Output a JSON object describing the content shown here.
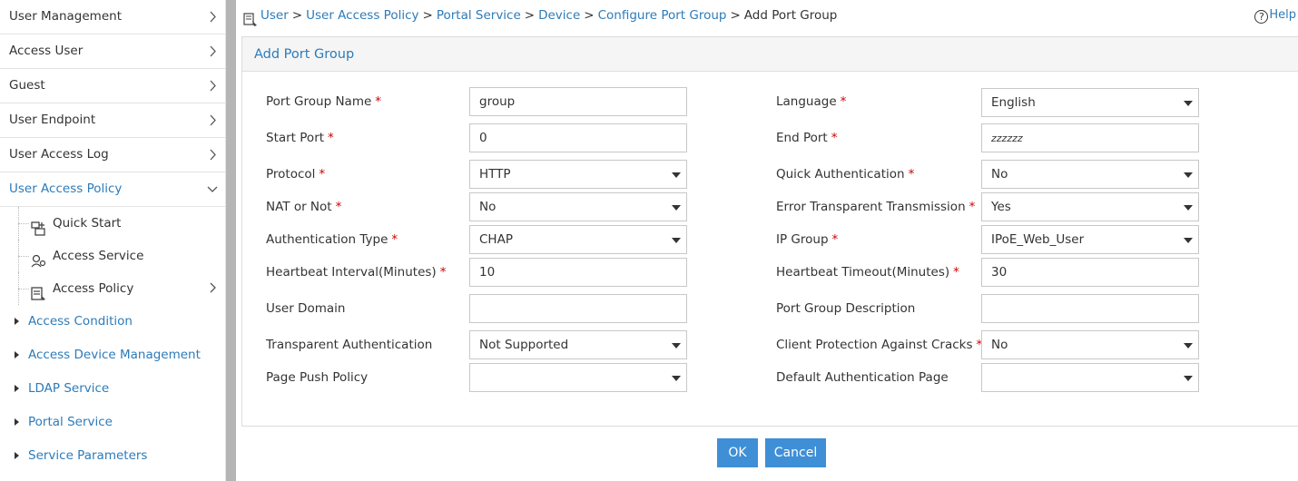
{
  "sidebar": {
    "top_items": [
      {
        "label": "User Management"
      },
      {
        "label": "Access User"
      },
      {
        "label": "Guest"
      },
      {
        "label": "User Endpoint"
      },
      {
        "label": "User Access Log"
      },
      {
        "label": "User Access Policy"
      }
    ],
    "sub_items": [
      {
        "label": "Quick Start"
      },
      {
        "label": "Access Service"
      },
      {
        "label": "Access Policy"
      }
    ],
    "tree_items": [
      {
        "label": "Access Condition"
      },
      {
        "label": "Access Device Management"
      },
      {
        "label": "LDAP Service"
      },
      {
        "label": "Portal Service"
      },
      {
        "label": "Service Parameters"
      }
    ]
  },
  "breadcrumb": {
    "items": [
      "User",
      "User Access Policy",
      "Portal Service",
      "Device",
      "Configure Port Group"
    ],
    "current": "Add Port Group",
    "separator": ">"
  },
  "help": {
    "label": "Help",
    "icon_glyph": "?"
  },
  "panel": {
    "title": "Add Port Group"
  },
  "form": {
    "port_group_name": {
      "label": "Port Group Name",
      "value": "group",
      "required": "*"
    },
    "language": {
      "label": "Language",
      "value": "English",
      "required": "*"
    },
    "start_port": {
      "label": "Start Port",
      "value": "0",
      "required": "*"
    },
    "end_port": {
      "label": "End Port",
      "value": "zzzzzz",
      "required": "*"
    },
    "protocol": {
      "label": "Protocol",
      "value": "HTTP",
      "required": "*"
    },
    "quick_auth": {
      "label": "Quick Authentication",
      "value": "No",
      "required": "*"
    },
    "nat": {
      "label": "NAT or Not",
      "value": "No",
      "required": "*"
    },
    "error_transparent": {
      "label": "Error Transparent Transmission",
      "value": "Yes",
      "required": "*"
    },
    "auth_type": {
      "label": "Authentication Type",
      "value": "CHAP",
      "required": "*"
    },
    "ip_group": {
      "label": "IP Group",
      "value": "IPoE_Web_User",
      "required": "*"
    },
    "heartbeat_interval": {
      "label": "Heartbeat Interval(Minutes)",
      "value": "10",
      "required": "*"
    },
    "heartbeat_timeout": {
      "label": "Heartbeat Timeout(Minutes)",
      "value": "30",
      "required": "*"
    },
    "user_domain": {
      "label": "User Domain",
      "value": ""
    },
    "port_group_desc": {
      "label": "Port Group Description",
      "value": ""
    },
    "transparent_auth": {
      "label": "Transparent Authentication",
      "value": "Not Supported"
    },
    "client_protection": {
      "label": "Client Protection Against Cracks",
      "value": "No",
      "required": "*"
    },
    "page_push_policy": {
      "label": "Page Push Policy",
      "value": ""
    },
    "default_auth_page": {
      "label": "Default Authentication Page",
      "value": ""
    }
  },
  "buttons": {
    "ok": "OK",
    "cancel": "Cancel"
  },
  "colors": {
    "accent": "#2d7bb9",
    "button": "#3e8fd6",
    "required": "#cc0000",
    "splitter": "#b5b5b5"
  }
}
